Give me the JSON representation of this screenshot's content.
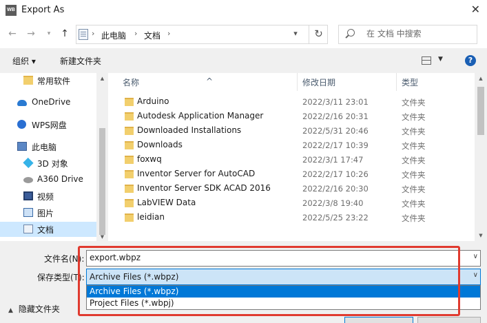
{
  "window": {
    "app_icon_text": "WB",
    "title": "Export As",
    "close_glyph": "✕"
  },
  "address_bar": {
    "breadcrumbs": [
      "此电脑",
      "文档"
    ],
    "separator": "›",
    "search_placeholder": "在 文档 中搜索"
  },
  "toolbar": {
    "organize": "组织 ▾",
    "new_folder": "新建文件夹"
  },
  "nav_pane": {
    "items": [
      {
        "label": "常用软件",
        "icon": "folder-icon"
      },
      {
        "label": "OneDrive",
        "icon": "cloud-icon"
      },
      {
        "label": "WPS网盘",
        "icon": "wps-icon"
      },
      {
        "label": "此电脑",
        "icon": "computer-icon"
      },
      {
        "label": "3D 对象",
        "icon": "3d-objects-icon"
      },
      {
        "label": "A360 Drive",
        "icon": "drive-icon"
      },
      {
        "label": "视频",
        "icon": "video-icon"
      },
      {
        "label": "图片",
        "icon": "pictures-icon"
      },
      {
        "label": "文档",
        "icon": "documents-icon",
        "selected": true
      }
    ]
  },
  "file_list": {
    "headers": {
      "name": "名称",
      "date": "修改日期",
      "type": "类型"
    },
    "rows": [
      {
        "name": "Arduino",
        "date": "2022/3/11 23:01",
        "type": "文件夹"
      },
      {
        "name": "Autodesk Application Manager",
        "date": "2022/2/16 20:31",
        "type": "文件夹"
      },
      {
        "name": "Downloaded Installations",
        "date": "2022/5/31 20:46",
        "type": "文件夹"
      },
      {
        "name": "Downloads",
        "date": "2022/2/17 10:39",
        "type": "文件夹"
      },
      {
        "name": "foxwq",
        "date": "2022/3/1 17:47",
        "type": "文件夹"
      },
      {
        "name": "Inventor Server for AutoCAD",
        "date": "2022/2/17 10:26",
        "type": "文件夹"
      },
      {
        "name": "Inventor Server SDK ACAD 2016",
        "date": "2022/2/16 20:30",
        "type": "文件夹"
      },
      {
        "name": "LabVIEW Data",
        "date": "2022/3/8 19:40",
        "type": "文件夹"
      },
      {
        "name": "leidian",
        "date": "2022/5/25 23:22",
        "type": "文件夹"
      }
    ]
  },
  "bottom": {
    "filename_label": "文件名(N):",
    "filename_value": "export.wbpz",
    "filetype_label": "保存类型(T):",
    "filetype_value": "Archive Files (*.wbpz)",
    "filetype_options": [
      "Archive Files (*.wbpz)",
      "Project Files (*.wbpj)"
    ],
    "hide_folders": "隐藏文件夹"
  },
  "colors": {
    "highlight": "#e03a2f",
    "selection": "#0078d7",
    "nav_selected": "#cde8ff"
  }
}
